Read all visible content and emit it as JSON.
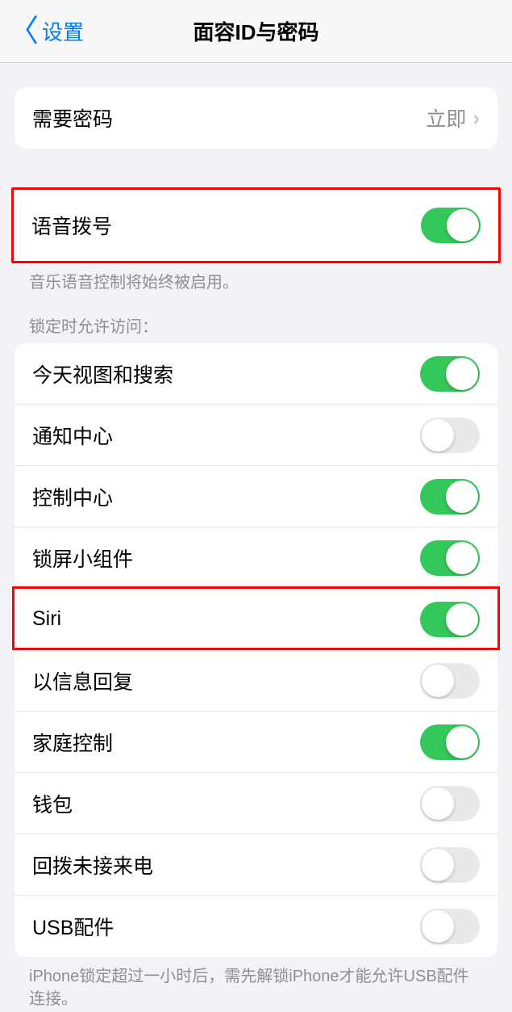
{
  "nav": {
    "back_label": "设置",
    "title": "面容ID与密码"
  },
  "require_passcode": {
    "label": "需要密码",
    "value": "立即"
  },
  "voice_dial": {
    "label": "语音拨号",
    "footer": "音乐语音控制将始终被启用。"
  },
  "lock_access": {
    "header": "锁定时允许访问：",
    "items": [
      {
        "label": "今天视图和搜索",
        "on": true
      },
      {
        "label": "通知中心",
        "on": false
      },
      {
        "label": "控制中心",
        "on": true
      },
      {
        "label": "锁屏小组件",
        "on": true
      },
      {
        "label": "Siri",
        "on": true
      },
      {
        "label": "以信息回复",
        "on": false
      },
      {
        "label": "家庭控制",
        "on": true
      },
      {
        "label": "钱包",
        "on": false
      },
      {
        "label": "回拨未接来电",
        "on": false
      },
      {
        "label": "USB配件",
        "on": false
      }
    ],
    "footer": "iPhone锁定超过一小时后，需先解锁iPhone才能允许USB配件连接。"
  }
}
